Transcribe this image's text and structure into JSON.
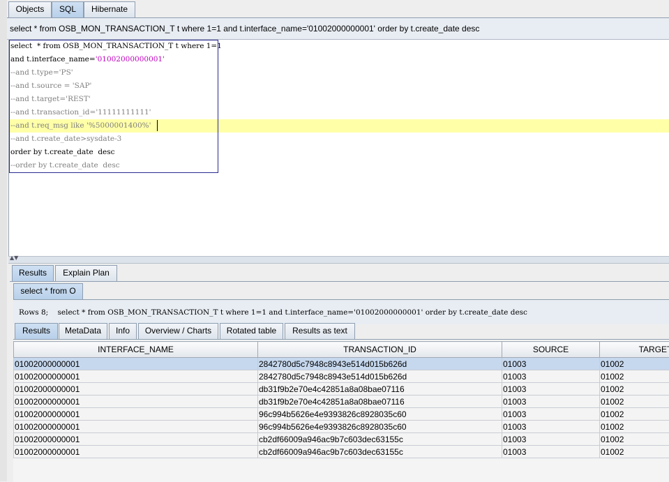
{
  "top_tabs": [
    "Objects",
    "SQL",
    "Hibernate"
  ],
  "query_header": "select * from OSB_MON_TRANSACTION_T t where 1=1 and t.interface_name='01002000000001' order by t.create_date desc",
  "editor": {
    "line1_a": "select  * from OSB_MON_TRANSACTION_T t where 1=1",
    "line2_a": "and t.interface_name=",
    "line2_b": "'01002000000001'",
    "line3": "--and t.type='PS'",
    "line4": "--and t.source = 'SAP'",
    "line5": "--and t.target='REST'",
    "line6": "--and t.transaction_id='11111111111'",
    "line7": "--and t.req_msg like '%5000001400%'",
    "line8": "--and t.create_date>sysdate-3",
    "line9": "order by t.create_date  desc",
    "line10": "--order by t.create_date  desc"
  },
  "lower_tabs": [
    "Results",
    "Explain Plan"
  ],
  "result_tab": "select * from O",
  "status_text": "Rows 8;    select * from OSB_MON_TRANSACTION_T t where 1=1 and t.interface_name='01002000000001' order by t.create_date desc",
  "result_subtabs": [
    "Results",
    "MetaData",
    "Info",
    "Overview / Charts",
    "Rotated table",
    "Results as text"
  ],
  "table": {
    "columns": [
      "INTERFACE_NAME",
      "TRANSACTION_ID",
      "SOURCE",
      "TARGET"
    ],
    "rows": [
      [
        "01002000000001",
        "2842780d5c7948c8943e514d015b626d",
        "01003",
        "01002"
      ],
      [
        "01002000000001",
        "2842780d5c7948c8943e514d015b626d",
        "01003",
        "01002"
      ],
      [
        "01002000000001",
        "db31f9b2e70e4c42851a8a08bae07116",
        "01003",
        "01002"
      ],
      [
        "01002000000001",
        "db31f9b2e70e4c42851a8a08bae07116",
        "01003",
        "01002"
      ],
      [
        "01002000000001",
        "96c994b5626e4e9393826c8928035c60",
        "01003",
        "01002"
      ],
      [
        "01002000000001",
        "96c994b5626e4e9393826c8928035c60",
        "01003",
        "01002"
      ],
      [
        "01002000000001",
        "cb2df66009a946ac9b7c603dec63155c",
        "01003",
        "01002"
      ],
      [
        "01002000000001",
        "cb2df66009a946ac9b7c603dec63155c",
        "01003",
        "01002"
      ]
    ]
  }
}
